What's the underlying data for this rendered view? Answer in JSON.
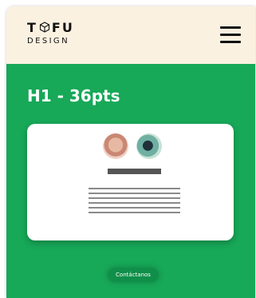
{
  "brand": {
    "word_top_left": "T",
    "word_top_right": "FU",
    "word_bottom": "DESIGN",
    "cube_icon": "cube-outline-icon"
  },
  "header": {
    "menu_icon": "hamburger-menu-icon",
    "background": "#fbf1e1"
  },
  "hero": {
    "heading": "H1 - 36pts",
    "background": "#17a858",
    "cta_label": "Contáctanos",
    "cta_color": "#0f8f49"
  },
  "card": {
    "avatars": [
      "avatar-photo",
      "avatar-photo"
    ],
    "text_line_count": 6
  }
}
